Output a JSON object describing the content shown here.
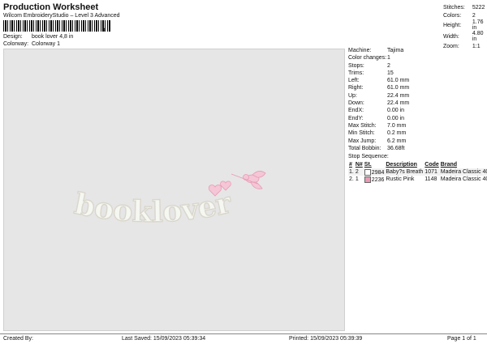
{
  "header": {
    "title": "Production Worksheet",
    "subtitle": "Wilcom EmbroideryStudio – Level 3 Advanced",
    "barcode_digit": "3",
    "design_label": "Design:",
    "design_value": "book lover 4,8 in",
    "colorway_label": "Colorway:",
    "colorway_value": "Colorway 1"
  },
  "top_right": [
    {
      "k": "Stitches:",
      "v": "5222"
    },
    {
      "k": "Colors:",
      "v": "2"
    },
    {
      "k": "Height:",
      "v": "1.76 in"
    },
    {
      "k": "Width:",
      "v": "4.80 in"
    },
    {
      "k": "Zoom:",
      "v": "1:1"
    }
  ],
  "info": [
    {
      "k": "Machine:",
      "v": "Tajima"
    },
    {
      "k": "Color changes:",
      "v": "1"
    },
    {
      "k": "Stops:",
      "v": "2"
    },
    {
      "k": "Trims:",
      "v": "15"
    },
    {
      "k": "Left:",
      "v": "61.0 mm"
    },
    {
      "k": "Right:",
      "v": "61.0 mm"
    },
    {
      "k": "Up:",
      "v": "22.4 mm"
    },
    {
      "k": "Down:",
      "v": "22.4 mm"
    },
    {
      "k": "EndX:",
      "v": "0.00 in"
    },
    {
      "k": "EndY:",
      "v": "0.00 in"
    },
    {
      "k": "Max Stitch:",
      "v": "7.0 mm"
    },
    {
      "k": "Min Stitch:",
      "v": "0.2 mm"
    },
    {
      "k": "Max Jump:",
      "v": "6.2 mm"
    },
    {
      "k": "Total Bobbin:",
      "v": "36.68ft"
    }
  ],
  "stop_sequence": {
    "label": "Stop Sequence:",
    "headers": [
      "#",
      "N#",
      "St.",
      "Description",
      "Code",
      "Brand"
    ],
    "rows": [
      {
        "n": "1.",
        "needle": "2",
        "swatch": "#ffffff",
        "st": "2984",
        "desc": "Baby?s Breath",
        "code": "1071",
        "brand": "Madeira Classic 40"
      },
      {
        "n": "2.",
        "needle": "1",
        "swatch": "#e89ab5",
        "st": "2236",
        "desc": "Rustic Pink",
        "code": "1148",
        "brand": "Madeira Classic 40"
      }
    ]
  },
  "design_text": "booklover",
  "footer": {
    "created_by": "Created By:",
    "last_saved": "Last Saved: 15/09/2023 05:39:34",
    "printed": "Printed: 15/09/2023 05:39:39",
    "page": "Page 1 of 1"
  },
  "colors": {
    "canvas": "#e6e6e6",
    "letter_fill": "#f5f7f1",
    "letter_outline": "#d9d6cc",
    "pink": "#e89ab5"
  }
}
